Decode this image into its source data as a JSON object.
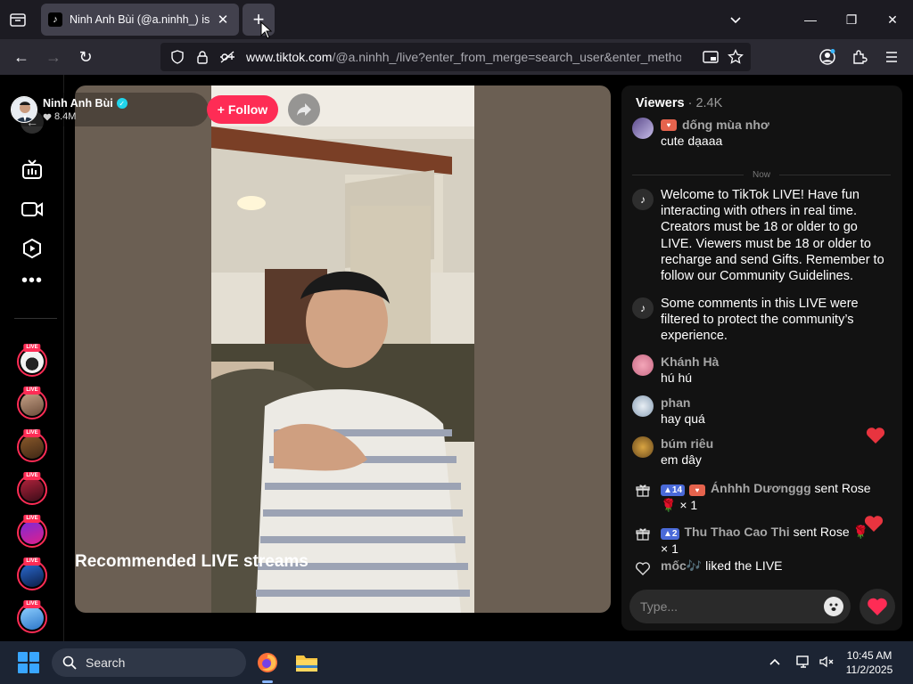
{
  "browser": {
    "tab_title": "Ninh Anh Bùi (@a.ninhh_) is LIVE",
    "url_host": "www.tiktok.com",
    "url_path": "/@a.ninhh_/live?enter_from_merge=search_user&enter_method=search"
  },
  "icons": {
    "tab_close": "✕",
    "new_tab": "+",
    "back": "←",
    "forward": "→",
    "reload": "↻",
    "list_all_tabs": "chevron-down-icon",
    "minimize": "—",
    "maximize": "❐",
    "close_window": "✕",
    "lnav_back": "←",
    "more": "•••"
  },
  "host": {
    "name": "Ninh Anh Bùi",
    "likes": "8.4M",
    "follow_label": "+ Follow"
  },
  "chat": {
    "header_label": "Viewers",
    "viewer_count": "· 2.4K",
    "now_label": "Now",
    "input_placeholder": "Type...",
    "messages": [
      {
        "user": "dống mùa nhơ",
        "text": "cute dạaaa"
      },
      {
        "system": "Welcome to TikTok LIVE! Have fun interacting with others in real time. Creators must be 18 or older to go LIVE. Viewers must be 18 or older to recharge and send Gifts. Remember to follow our Community Guidelines."
      },
      {
        "system": "Some comments in this LIVE were filtered to protect the community’s experience."
      },
      {
        "user": "Khánh Hà",
        "text": "hú hú"
      },
      {
        "user": "phan",
        "text": "hay quá"
      },
      {
        "user": "búm riêu",
        "text": "em dây"
      }
    ],
    "gifts": [
      {
        "level": "14",
        "user": "Ánhhh Dươnggg",
        "action": "sent Rose",
        "qty": "× 1"
      },
      {
        "level": "2",
        "user": "Thu Thao Cao Thi",
        "action": "sent Rose",
        "qty": "× 1"
      }
    ],
    "like_event": {
      "user": "mốc🎶",
      "action": "liked the LIVE"
    }
  },
  "page": {
    "recommended_title": "Recommended LIVE streams"
  },
  "taskbar": {
    "search_label": "Search",
    "time": "10:45 AM",
    "date": "11/2/2025"
  },
  "colors": {
    "accent": "#fe2c55",
    "verified": "#20d5ec",
    "chat_bg": "#121212",
    "browser_tabbar": "#1c1b22",
    "browser_toolbar": "#2b2a33"
  }
}
